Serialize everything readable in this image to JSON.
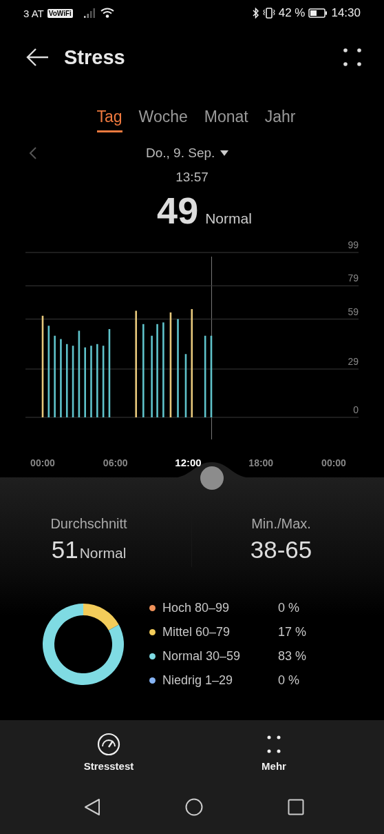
{
  "status_bar": {
    "carrier": "3 AT",
    "wifi_calling": "VoWiFi",
    "battery": "42 %",
    "time": "14:30"
  },
  "header": {
    "title": "Stress"
  },
  "tabs": [
    {
      "label": "Tag",
      "selected": true
    },
    {
      "label": "Woche",
      "selected": false
    },
    {
      "label": "Monat",
      "selected": false
    },
    {
      "label": "Jahr",
      "selected": false
    }
  ],
  "date": "Do., 9. Sep.",
  "reading": {
    "time": "13:57",
    "value": "49",
    "label": "Normal"
  },
  "chart_data": {
    "type": "bar",
    "x": [
      0,
      0.5,
      1,
      1.5,
      2,
      2.5,
      3,
      3.5,
      4,
      4.5,
      5,
      5.5,
      7.7,
      8.3,
      9,
      9.45,
      9.95,
      10.55,
      11.15,
      11.8,
      12.3,
      13.4,
      13.9
    ],
    "grid": true,
    "series": [
      {
        "color": "#e8c97c",
        "values": [
          61,
          null,
          null,
          null,
          null,
          null,
          null,
          null,
          null,
          null,
          null,
          null,
          64,
          null,
          null,
          null,
          null,
          63,
          null,
          null,
          65,
          null,
          null
        ]
      },
      {
        "color": "#5fc3cb",
        "values": [
          null,
          55,
          49,
          47,
          44,
          43,
          52,
          42,
          43,
          44,
          43,
          53,
          null,
          56,
          49,
          56,
          57,
          null,
          59,
          38,
          null,
          49,
          49
        ]
      }
    ],
    "xlim": [
      0,
      24
    ],
    "ylim": [
      0,
      99
    ],
    "xticks": [
      {
        "value": 0,
        "label": "00:00"
      },
      {
        "value": 6,
        "label": "06:00"
      },
      {
        "value": 12,
        "label": "12:00"
      },
      {
        "value": 18,
        "label": "18:00"
      },
      {
        "value": 24,
        "label": "00:00"
      }
    ],
    "yticks": [
      0,
      29,
      59,
      79,
      99
    ]
  },
  "summary": [
    {
      "label": "Durchschnitt",
      "value": "51",
      "note": "Normal"
    },
    {
      "label": "Min./Max.",
      "value": "38-65"
    }
  ],
  "distribution": {
    "chart_data": {
      "type": "donut",
      "categories": [
        "Hoch 80–99",
        "Mittel 60–79",
        "Normal 30–59",
        "Niedrig 1–29"
      ],
      "series": [
        {
          "values": [
            0,
            17,
            83,
            0
          ]
        }
      ]
    },
    "legend": [
      {
        "percent": "0 %",
        "color": "#f0925a"
      },
      {
        "percent": "17 %",
        "color": "#f3cc5a"
      },
      {
        "percent": "83 %",
        "color": "#7fdbe3"
      },
      {
        "percent": "0 %",
        "color": "#86b4f5"
      }
    ]
  },
  "bottom_nav": [
    {
      "label": "Stresstest",
      "kind": "gauge"
    },
    {
      "label": "Mehr",
      "kind": "dots"
    }
  ]
}
